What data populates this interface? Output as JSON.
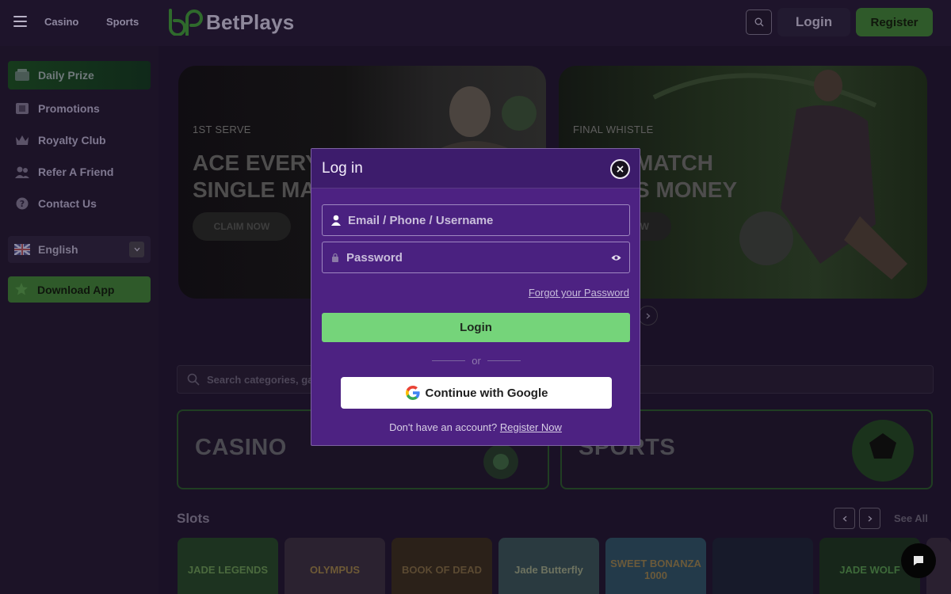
{
  "header": {
    "nav_tabs": [
      "Casino",
      "Sports"
    ],
    "logo_text": "BetPlays",
    "login_label": "Login",
    "register_label": "Register"
  },
  "sidebar": {
    "items": [
      {
        "label": "Daily Prize",
        "icon": "gift-icon",
        "active": true
      },
      {
        "label": "Promotions",
        "icon": "promotions-icon"
      },
      {
        "label": "Royalty Club",
        "icon": "crown-icon"
      },
      {
        "label": "Refer A Friend",
        "icon": "users-icon"
      },
      {
        "label": "Contact Us",
        "icon": "help-icon"
      }
    ],
    "language": "English",
    "download_label": "Download App"
  },
  "banners": [
    {
      "eyebrow": "1ST SERVE",
      "headline": "ACE EVERY\nSINGLE MAT",
      "cta": "CLAIM NOW"
    },
    {
      "eyebrow": "FINAL WHISTLE",
      "headline": "MATCH\nS MONEY",
      "cta": "W"
    }
  ],
  "search": {
    "placeholder": "Search categories, ga"
  },
  "categories": [
    "CASINO",
    "SPORTS"
  ],
  "slots": {
    "title": "Slots",
    "see_all": "See All",
    "games": [
      "JADE LEGENDS",
      "OLYMPUS",
      "BOOK OF DEAD",
      "Jade Butterfly",
      "SWEET BONANZA 1000",
      "",
      "JADE WOLF"
    ]
  },
  "modal": {
    "title": "Log in",
    "username_placeholder": "Email / Phone / Username",
    "password_placeholder": "Password",
    "forgot_label": "Forgot your Password",
    "login_label": "Login",
    "or_label": "or",
    "google_label": "Continue with Google",
    "signup_prompt": "Don't have an account?",
    "signup_link": "Register Now"
  },
  "colors": {
    "accent_green": "#75d47a",
    "modal_bg": "#4d2282",
    "page_bg": "#1a1126"
  }
}
